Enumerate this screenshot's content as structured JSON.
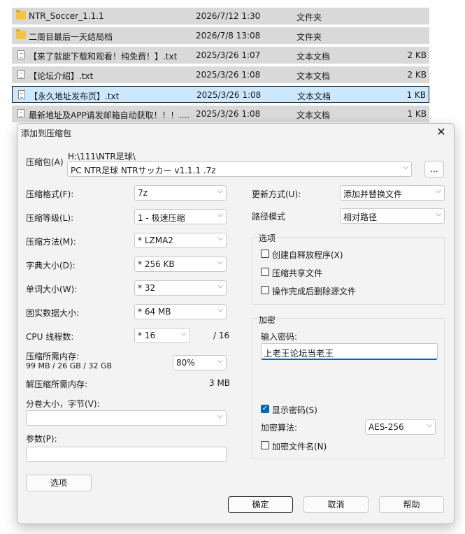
{
  "files": [
    {
      "name": "NTR_Soccer_1.1.1",
      "date": "2026/7/12 1:30",
      "type": "文件夹",
      "size": "",
      "icon": "folder-icon"
    },
    {
      "name": "二周目最后一天结局档",
      "date": "2026/7/8 13:08",
      "type": "文件夹",
      "size": "",
      "icon": "folder-icon"
    },
    {
      "name": "【来了就能下载和观看！纯免费！】.txt",
      "date": "2025/3/26 1:07",
      "type": "文本文档",
      "size": "2 KB",
      "icon": "text-file-icon"
    },
    {
      "name": "【论坛介绍】.txt",
      "date": "2025/3/26 1:08",
      "type": "文本文档",
      "size": "2 KB",
      "icon": "text-file-icon"
    },
    {
      "name": "【永久地址发布页】.txt",
      "date": "2025/3/26 1:08",
      "type": "文本文档",
      "size": "1 KB",
      "icon": "text-file-icon"
    },
    {
      "name": "最新地址及APP请发邮箱自动获取！！！....",
      "date": "2025/3/26 1:08",
      "type": "文本文档",
      "size": "1 KB",
      "icon": "text-file-icon"
    }
  ],
  "dialog": {
    "title": "添加到压缩包",
    "close": "✕",
    "archive_label": "压缩包(A)",
    "archive_dir": "H:\\111\\NTR足球\\",
    "archive_name": "PC NTR足球 NTRサッカー v1.1.1 .7z",
    "browse": "...",
    "format_label": "压缩格式(F):",
    "format_value": "7z",
    "level_label": "压缩等级(L):",
    "level_value": "1 - 极速压缩",
    "method_label": "压缩方法(M):",
    "method_value": "* LZMA2",
    "dict_label": "字典大小(D):",
    "dict_value": "* 256 KB",
    "word_label": "单词大小(W):",
    "word_value": "* 32",
    "solid_label": "固实数据大小:",
    "solid_value": "* 64 MB",
    "cpu_label": "CPU 线程数:",
    "cpu_value": "* 16",
    "cpu_total": "/ 16",
    "mem_comp_label": "压缩所需内存:",
    "mem_comp_value": "99 MB / 26 GB / 32 GB",
    "mem_percent": "80%",
    "mem_decomp_label": "解压缩所需内存:",
    "mem_decomp_value": "3 MB",
    "split_label": "分卷大小，字节(V):",
    "split_value": "",
    "params_label": "参数(P):",
    "params_value": "",
    "options_button": "选项",
    "update_label": "更新方式(U):",
    "update_value": "添加并替换文件",
    "path_label": "路径模式",
    "path_value": "相对路径",
    "options_group": "选项",
    "opt_sfx": "创建自释放程序(X)",
    "opt_shared": "压缩共享文件",
    "opt_delete": "操作完成后删除源文件",
    "encrypt_group": "加密",
    "password_label": "输入密码:",
    "password_value": "上老王论坛当老王",
    "show_password": "显示密码(S)",
    "enc_method_label": "加密算法:",
    "enc_method_value": "AES-256",
    "enc_names": "加密文件名(N)",
    "ok": "确定",
    "cancel": "取消",
    "help": "帮助"
  },
  "colors": {
    "selection": "#cce8ff",
    "accent": "#0067c0",
    "row_bg": "#d9d9d9"
  }
}
